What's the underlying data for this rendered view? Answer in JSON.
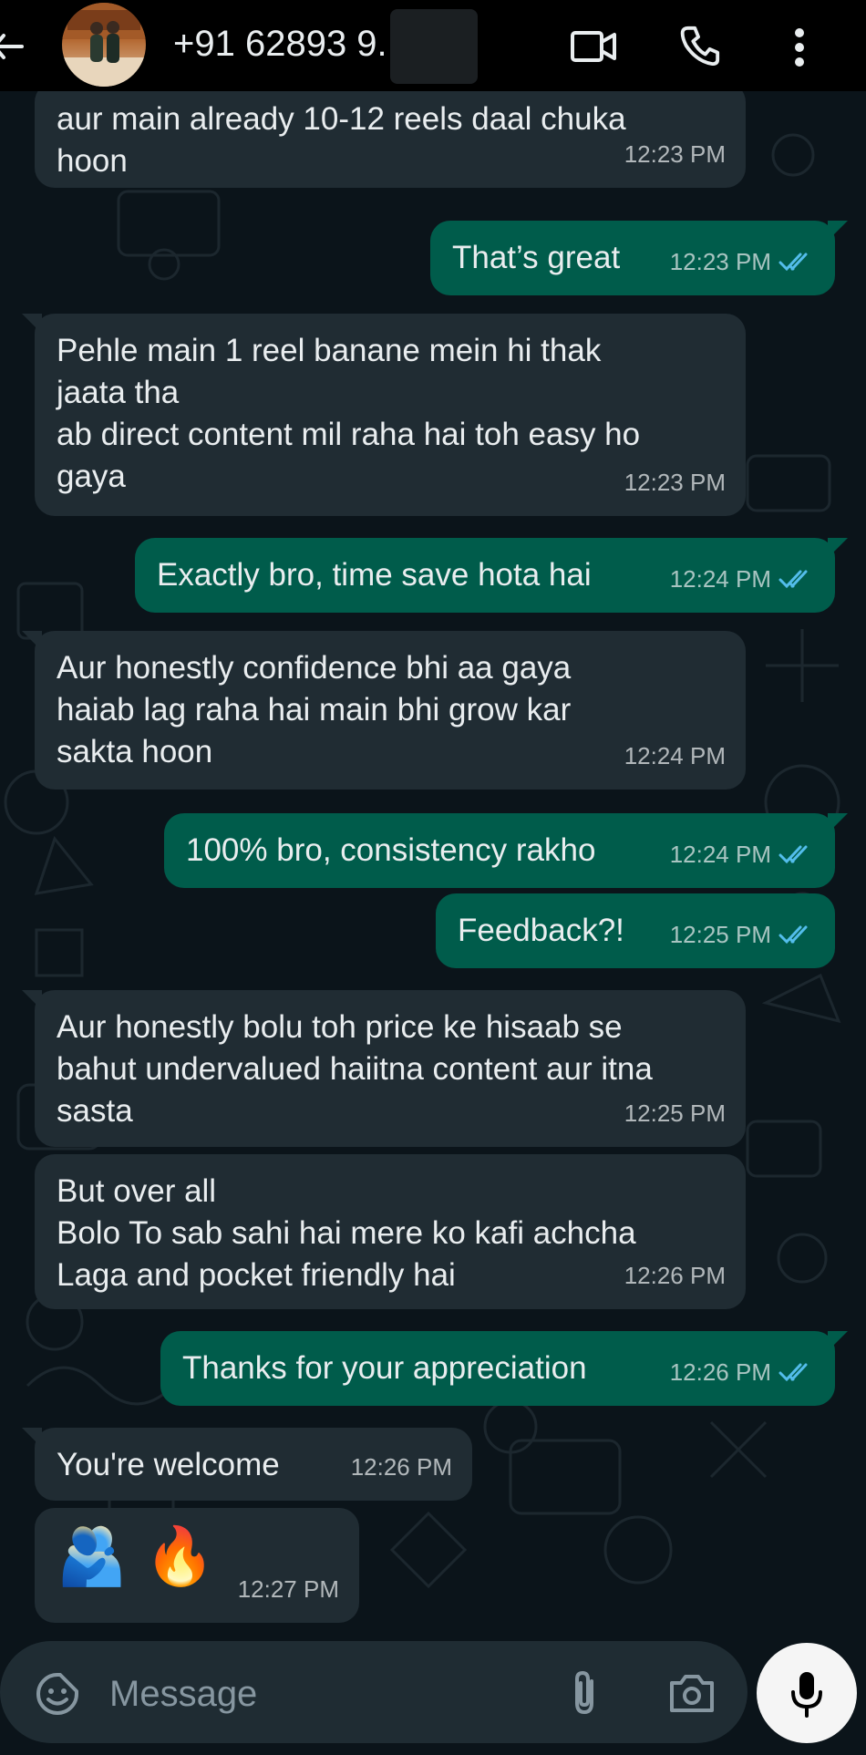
{
  "header": {
    "contact_name": "+91 62893 9.",
    "back_icon": "back-arrow-icon",
    "video_icon": "video-call-icon",
    "call_icon": "phone-icon",
    "menu_icon": "more-vert-icon"
  },
  "colors": {
    "incoming_bubble": "#202c33",
    "outgoing_bubble": "#005c4b",
    "background": "#0b141a",
    "read_ticks": "#53bdeb"
  },
  "messages": [
    {
      "dir": "in",
      "text": "aur main already 10-12 reels daal chuka\nhoon",
      "time": "12:23 PM"
    },
    {
      "dir": "out",
      "text": "That’s great",
      "time": "12:23 PM",
      "status": "read"
    },
    {
      "dir": "in",
      "text": "Pehle main 1 reel banane mein hi thak\njaata tha\nab direct content mil raha hai toh easy ho\ngaya",
      "time": "12:23 PM"
    },
    {
      "dir": "out",
      "text": "Exactly bro, time save hota hai",
      "time": "12:24 PM",
      "status": "read"
    },
    {
      "dir": "in",
      "text": "Aur honestly confidence bhi aa gaya\nhaiab lag raha hai main bhi grow kar\nsakta hoon",
      "time": "12:24 PM"
    },
    {
      "dir": "out",
      "text": "100% bro, consistency rakho",
      "time": "12:24 PM",
      "status": "read"
    },
    {
      "dir": "out",
      "text": "Feedback?!",
      "time": "12:25 PM",
      "status": "read"
    },
    {
      "dir": "in",
      "text": "Aur honestly bolu toh price ke hisaab se\nbahut undervalued haiitna content aur itna\nsasta",
      "time": "12:25 PM"
    },
    {
      "dir": "in",
      "text": "But over all\n Bolo To sab sahi hai  mere ko kafi achcha\nLaga and pocket friendly hai",
      "time": "12:26 PM"
    },
    {
      "dir": "out",
      "text": "Thanks for your appreciation",
      "time": "12:26 PM",
      "status": "read"
    },
    {
      "dir": "in",
      "text": "You're welcome",
      "time": "12:26 PM"
    },
    {
      "dir": "in",
      "text": "🫂 🔥",
      "time": "12:27 PM",
      "emoji": true
    }
  ],
  "composer": {
    "placeholder": "Message",
    "emoji_icon": "emoji-sticker-icon",
    "attach_icon": "paperclip-icon",
    "camera_icon": "camera-icon",
    "mic_icon": "microphone-icon"
  }
}
